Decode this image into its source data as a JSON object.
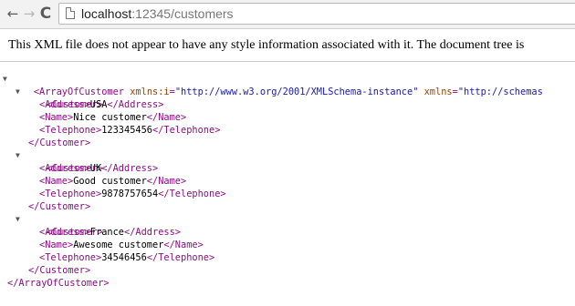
{
  "nav": {
    "back_icon": "←",
    "forward_icon": "→",
    "reload_icon": "C"
  },
  "address_bar": {
    "host": "localhost",
    "path": ":12345/customers"
  },
  "info_message": "This XML file does not appear to have any style information associated with it. The document tree is",
  "xml": {
    "root_open": "<ArrayOfCustomer",
    "root_attr1_name": "xmlns:i",
    "root_attr1_value": "\"http://www.w3.org/2001/XMLSchema-instance\"",
    "root_attr2_name": "xmlns",
    "root_attr2_value": "\"http://schemas",
    "root_close": "</ArrayOfCustomer>",
    "customer_open": "<Customer>",
    "customer_close": "</Customer>",
    "customers": [
      {
        "address": "USA",
        "name": "Nice customer",
        "telephone": "123345456"
      },
      {
        "address": "UK",
        "name": "Good customer",
        "telephone": "9878757654"
      },
      {
        "address": "France",
        "name": "Awesome customer",
        "telephone": "34546456"
      }
    ],
    "tags": {
      "address_open": "<Address>",
      "address_close": "</Address>",
      "name_open": "<Name>",
      "name_close": "</Name>",
      "telephone_open": "<Telephone>",
      "telephone_close": "</Telephone>"
    },
    "collapse_arrow": "▼"
  }
}
